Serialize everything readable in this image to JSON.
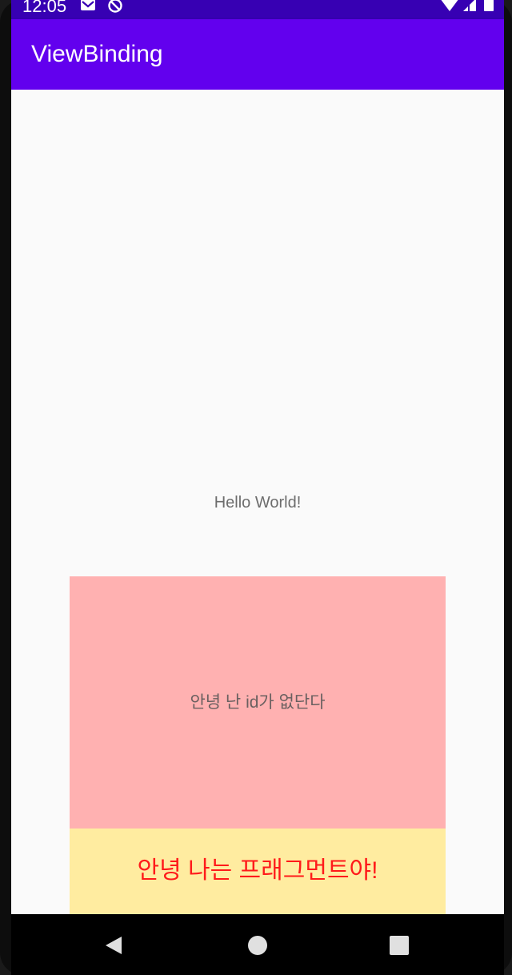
{
  "status_bar": {
    "time": "12:05",
    "icons": [
      "gmail-icon",
      "do-not-disturb-icon",
      "wifi-icon",
      "signal-icon",
      "battery-icon"
    ]
  },
  "app_bar": {
    "title": "ViewBinding"
  },
  "main": {
    "hello_text": "Hello World!",
    "pink_box_text": "안녕 난 id가 없단다",
    "fragment_text": "안녕 나는 프래그먼트야!"
  },
  "nav_bar": {
    "buttons": [
      "back-icon",
      "home-icon",
      "recents-icon"
    ]
  },
  "colors": {
    "status_bar": "#3700b3",
    "app_bar": "#6200ee",
    "pink_box": "#ffb1b1",
    "yellow_box": "#ffeca0",
    "fragment_text": "#ff1a1a"
  }
}
